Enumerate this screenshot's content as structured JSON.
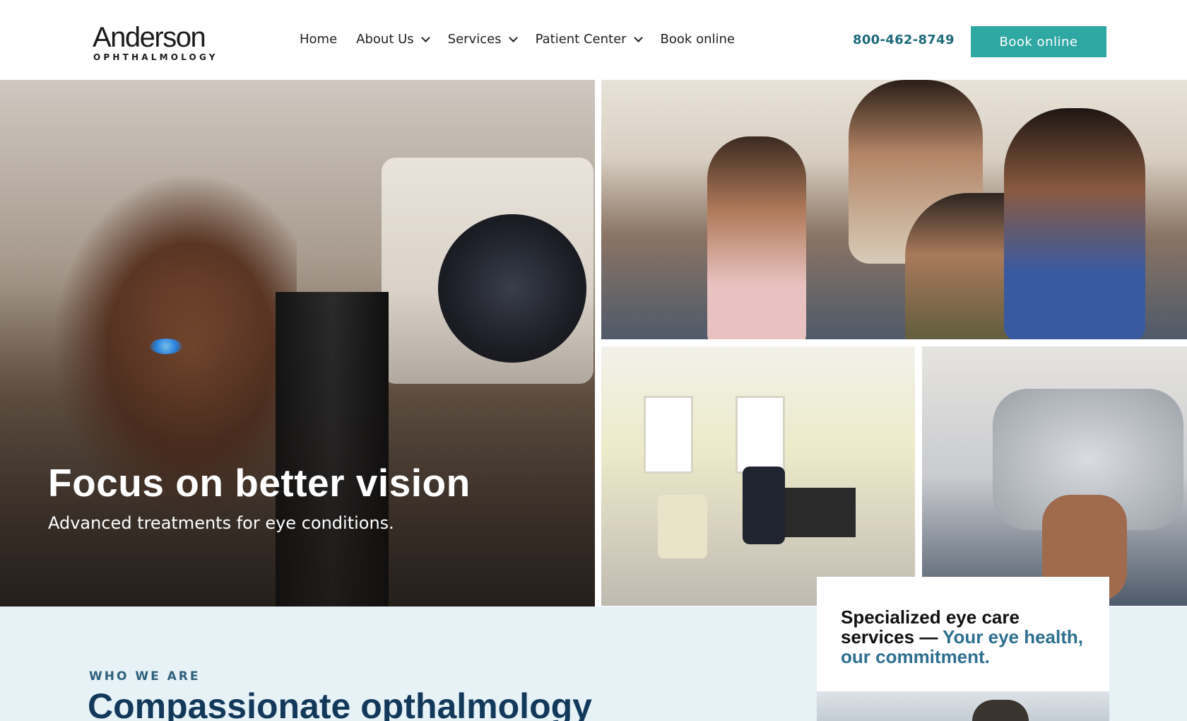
{
  "header": {
    "logo_main": "Anderson",
    "logo_sub": "OPHTHALMOLOGY",
    "nav": [
      {
        "label": "Home",
        "has_dropdown": false
      },
      {
        "label": "About Us",
        "has_dropdown": true
      },
      {
        "label": "Services",
        "has_dropdown": true
      },
      {
        "label": "Patient Center",
        "has_dropdown": true
      },
      {
        "label": "Book online",
        "has_dropdown": false
      }
    ],
    "phone": "800-462-8749",
    "cta_label": "Book online"
  },
  "hero": {
    "title": "Focus on better vision",
    "subtitle": "Advanced treatments for eye conditions."
  },
  "about": {
    "eyebrow": "WHO WE ARE",
    "title": "Compassionate opthalmology"
  },
  "card": {
    "text_main": "Specialized eye care services — ",
    "text_accent": "Your eye health, our commitment."
  },
  "colors": {
    "accent": "#2fa7a3",
    "phone": "#1d6b7a",
    "navy": "#12385a",
    "section_bg": "#e6f2f6"
  }
}
